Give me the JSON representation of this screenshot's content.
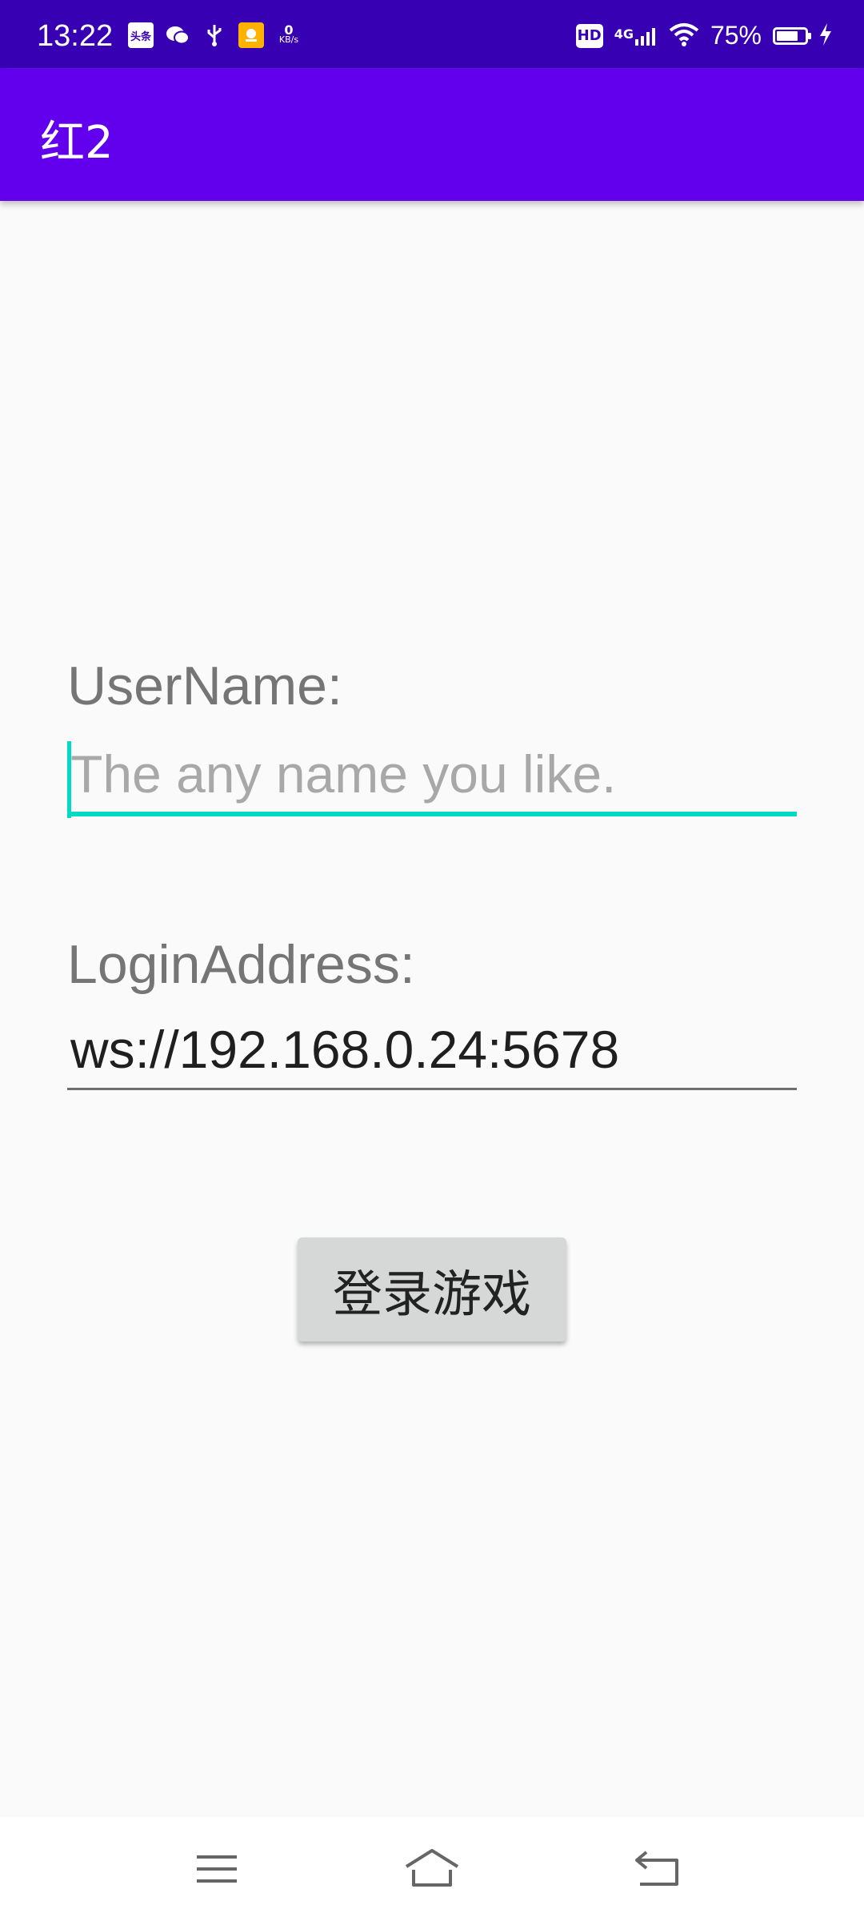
{
  "status_bar": {
    "time": "13:22",
    "left_icons": [
      "toutiao-icon",
      "wechat-icon",
      "usb-icon",
      "app-notification-icon"
    ],
    "toutiao_label": "头条",
    "net_speed_value": "0",
    "net_speed_unit": "KB/s",
    "hd_label": "HD",
    "network_label": "4G",
    "battery_percent": "75%",
    "battery_level": 0.75
  },
  "app_bar": {
    "title": "红2"
  },
  "form": {
    "username_label": "UserName:",
    "username_placeholder": "The any name you like.",
    "username_value": "",
    "address_label": "LoginAddress:",
    "address_value": "ws://192.168.0.24:5678",
    "login_button": "登录游戏"
  },
  "colors": {
    "status_bar": "#3700b3",
    "app_bar": "#6200ee",
    "accent": "#03dac6",
    "background": "#fafafa",
    "button": "#d6d7d7"
  },
  "nav_bar": {
    "icons": [
      "menu-icon",
      "home-icon",
      "back-icon"
    ]
  }
}
